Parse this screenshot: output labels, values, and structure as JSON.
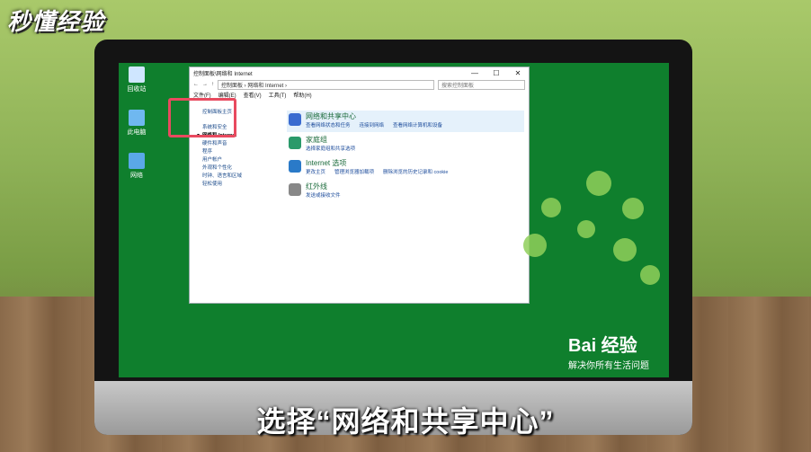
{
  "brand": "秒懂经验",
  "caption": "选择“网络和共享中心”",
  "desktop": [
    {
      "label": "回收站",
      "name": "recycle-bin-icon",
      "color": "#cfe6ff"
    },
    {
      "label": "此电脑",
      "name": "this-pc-icon",
      "color": "#6fb8f0"
    },
    {
      "label": "网络",
      "name": "network-icon",
      "color": "#5aa8e8"
    }
  ],
  "window": {
    "title": "控制面板\\网络和 Internet",
    "controls": [
      "—",
      "☐",
      "✕"
    ],
    "address": "控制面板 › 网络和 Internet ›",
    "search_placeholder": "搜索控制面板",
    "menu": [
      "文件(F)",
      "编辑(E)",
      "查看(V)",
      "工具(T)",
      "帮助(H)"
    ],
    "left_nav": [
      {
        "label": "控制面板主页",
        "active": false
      },
      {
        "label": "系统和安全",
        "active": false
      },
      {
        "label": "网络和 Internet",
        "active": true
      },
      {
        "label": "硬件和声音",
        "active": false
      },
      {
        "label": "程序",
        "active": false
      },
      {
        "label": "用户帐户",
        "active": false
      },
      {
        "label": "外观和个性化",
        "active": false
      },
      {
        "label": "时钟、语言和区域",
        "active": false
      },
      {
        "label": "轻松使用",
        "active": false
      }
    ],
    "categories": [
      {
        "title": "网络和共享中心",
        "links": [
          "查看网络状态和任务",
          "连接到网络",
          "查看网络计算机和设备"
        ],
        "color": "#3a6bd0",
        "highlight": true
      },
      {
        "title": "家庭组",
        "links": [
          "选择家庭组和共享选项"
        ],
        "color": "#2a9a6a",
        "highlight": false
      },
      {
        "title": "Internet 选项",
        "links": [
          "更改主页",
          "管理浏览器加载项",
          "删除浏览的历史记录和 cookie"
        ],
        "color": "#2a7ac8",
        "highlight": false
      },
      {
        "title": "红外线",
        "links": [
          "发送或接收文件"
        ],
        "color": "#888888",
        "highlight": false
      }
    ]
  },
  "baidu": {
    "logo": "Bai 经验",
    "slogan": "解决你所有生活问题"
  }
}
